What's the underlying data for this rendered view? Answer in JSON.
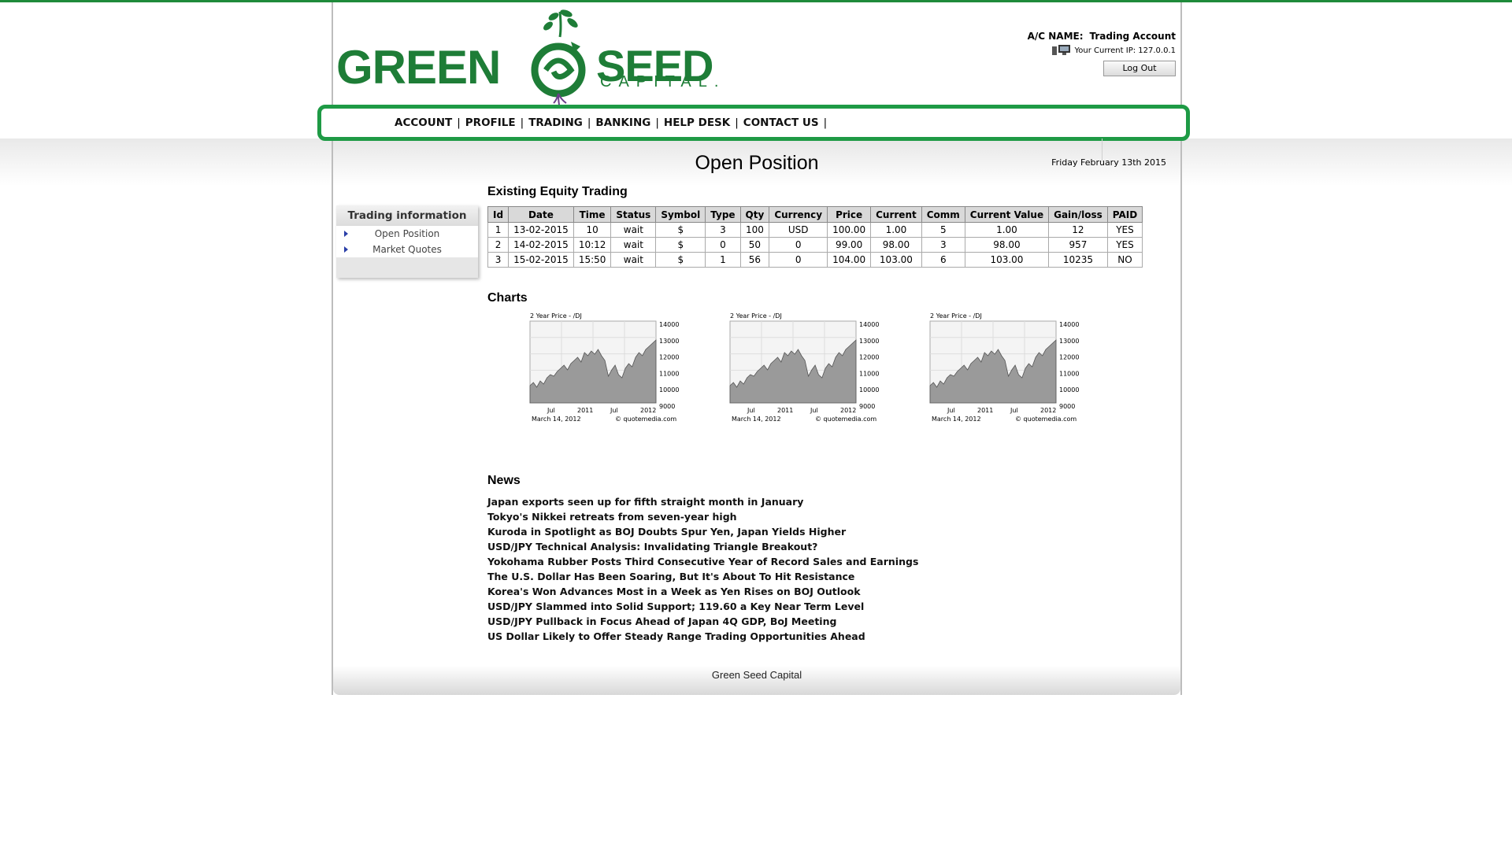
{
  "brand": {
    "word1": "GREEN",
    "word2": "SEED",
    "word3": "CAPITAL.",
    "color": "#1e7d37"
  },
  "account": {
    "label": "A/C NAME:",
    "name": "Trading Account",
    "ip_text": "Your Current IP: 127.0.0.1",
    "logout": "Log Out"
  },
  "nav": {
    "items": [
      "ACCOUNT",
      "PROFILE",
      "TRADING",
      "BANKING",
      "HELP DESK",
      "CONTACT US"
    ],
    "separator": "|",
    "border_color": "#1e9a45"
  },
  "header": {
    "title": "Open Position",
    "date": "Friday February 13th 2015"
  },
  "sidebar": {
    "title": "Trading information",
    "items": [
      "Open Position",
      "Market Quotes"
    ]
  },
  "equity": {
    "heading": "Existing Equity Trading",
    "columns": [
      "Id",
      "Date",
      "Time",
      "Status",
      "Symbol",
      "Type",
      "Qty",
      "Currency",
      "Price",
      "Current",
      "Comm",
      "Current Value",
      "Gain/loss",
      "PAID"
    ],
    "rows": [
      [
        "1",
        "13-02-2015",
        "10",
        "wait",
        "$",
        "3",
        "100",
        "USD",
        "100.00",
        "1.00",
        "5",
        "1.00",
        "12",
        "YES"
      ],
      [
        "2",
        "14-02-2015",
        "10:12",
        "wait",
        "$",
        "0",
        "50",
        "0",
        "99.00",
        "98.00",
        "3",
        "98.00",
        "957",
        "YES"
      ],
      [
        "3",
        "15-02-2015",
        "15:50",
        "wait",
        "$",
        "1",
        "56",
        "0",
        "104.00",
        "103.00",
        "6",
        "103.00",
        "10235",
        "NO"
      ]
    ]
  },
  "charts": {
    "heading": "Charts",
    "items": [
      {
        "title": "2 Year Price - /DJ",
        "date": "March 14, 2012",
        "credit": "© quotemedia.com",
        "yticks": [
          "14000",
          "13000",
          "12000",
          "11000",
          "10000",
          "9000"
        ],
        "xticks": [
          "Jul",
          "2011",
          "Jul",
          "2012"
        ]
      },
      {
        "title": "2 Year Price - /DJ",
        "date": "March 14, 2012",
        "credit": "© quotemedia.com",
        "yticks": [
          "14000",
          "13000",
          "12000",
          "11000",
          "10000",
          "9000"
        ],
        "xticks": [
          "Jul",
          "2011",
          "Jul",
          "2012"
        ]
      },
      {
        "title": "2 Year Price - /DJ",
        "date": "March 14, 2012",
        "credit": "© quotemedia.com",
        "yticks": [
          "14000",
          "13000",
          "12000",
          "11000",
          "10000",
          "9000"
        ],
        "xticks": [
          "Jul",
          "2011",
          "Jul",
          "2012"
        ]
      }
    ]
  },
  "news": {
    "heading": "News",
    "items": [
      "Japan exports seen up for fifth straight month in January",
      "Tokyo's Nikkei retreats from seven-year high",
      "Kuroda in Spotlight as BOJ Doubts Spur Yen, Japan Yields Higher",
      "USD/JPY Technical Analysis: Invalidating Triangle Breakout?",
      "Yokohama Rubber Posts Third Consecutive Year of Record Sales and Earnings",
      "The U.S. Dollar Has Been Soaring, But It's About To Hit Resistance",
      "Korea's Won Advances Most in a Week as Yen Rises on BOJ Outlook",
      "USD/JPY Slammed into Solid Support; 119.60 a Key Near Term Level",
      "USD/JPY Pullback in Focus Ahead of Japan 4Q GDP, BoJ Meeting",
      "US Dollar Likely to Offer Steady Range Trading Opportunities Ahead"
    ]
  },
  "footer": {
    "text": "Green Seed Capital"
  }
}
